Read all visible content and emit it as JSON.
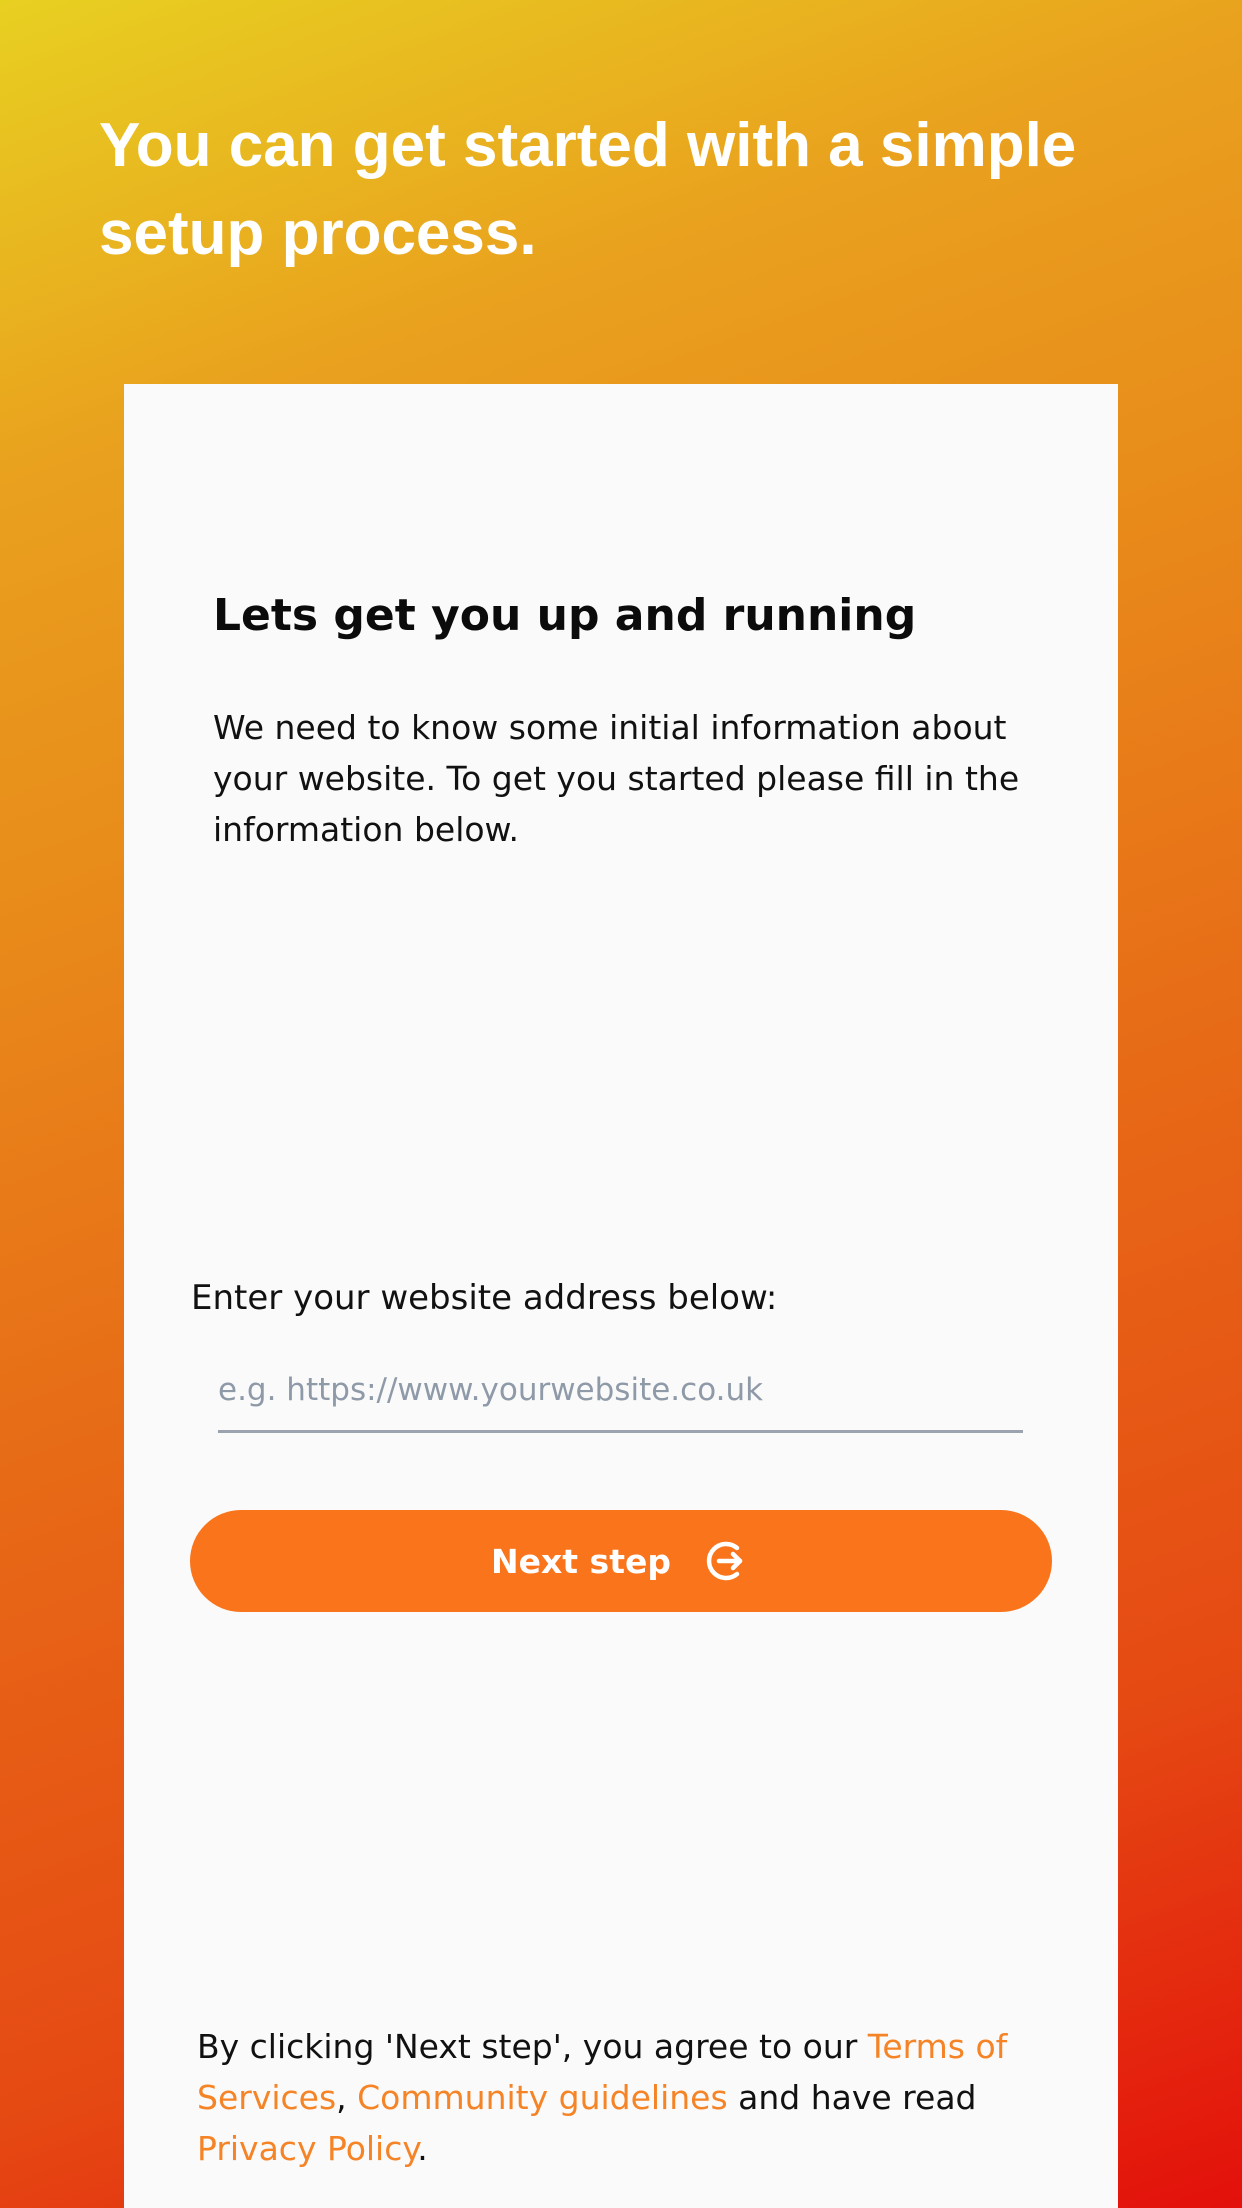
{
  "headline": "You can get started with a simple setup process.",
  "card": {
    "title": "Lets get you up and running",
    "description": "We need to know some initial information about your website. To get you started please fill in the information below.",
    "field_label": "Enter your website address below:",
    "website_input": {
      "placeholder": "e.g. https://www.yourwebsite.co.uk",
      "value": ""
    },
    "next_button": {
      "label": "Next step",
      "icon": "circle-arrow-right-icon"
    },
    "legal": {
      "prefix": "By clicking 'Next step', you agree to our ",
      "terms_link": "Terms of Services",
      "comma": ", ",
      "guidelines_link": "Community guidelines",
      "middle": " and have read  ",
      "privacy_link": "Privacy Policy",
      "suffix": "."
    }
  },
  "colors": {
    "gradient_top": "#E8D021",
    "gradient_bottom": "#E3100B",
    "accent": "#F9741B",
    "link": "#F58427",
    "card_background": "#FAFAFA"
  }
}
